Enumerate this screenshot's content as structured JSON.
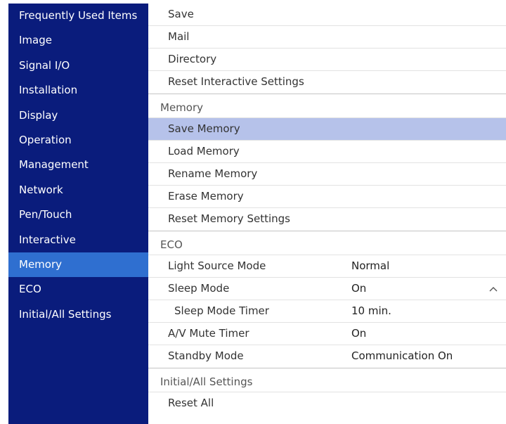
{
  "sidebar": {
    "items": [
      {
        "label": "Frequently Used Items"
      },
      {
        "label": "Image"
      },
      {
        "label": "Signal I/O"
      },
      {
        "label": "Installation"
      },
      {
        "label": "Display"
      },
      {
        "label": "Operation"
      },
      {
        "label": "Management"
      },
      {
        "label": "Network"
      },
      {
        "label": "Pen/Touch"
      },
      {
        "label": "Interactive"
      },
      {
        "label": "Memory"
      },
      {
        "label": "ECO"
      },
      {
        "label": "Initial/All Settings"
      }
    ],
    "active": "Memory"
  },
  "main": {
    "top_items": [
      {
        "label": "Save"
      },
      {
        "label": "Mail"
      },
      {
        "label": "Directory"
      },
      {
        "label": "Reset Interactive Settings"
      }
    ],
    "memory": {
      "heading": "Memory",
      "items": [
        {
          "label": "Save Memory"
        },
        {
          "label": "Load Memory"
        },
        {
          "label": "Rename Memory"
        },
        {
          "label": "Erase Memory"
        },
        {
          "label": "Reset Memory Settings"
        }
      ]
    },
    "eco": {
      "heading": "ECO",
      "items": [
        {
          "label": "Light Source Mode",
          "value": "Normal"
        },
        {
          "label": "Sleep Mode",
          "value": "On"
        },
        {
          "label": "Sleep Mode Timer",
          "value": "10 min."
        },
        {
          "label": "A/V Mute Timer",
          "value": "On"
        },
        {
          "label": "Standby Mode",
          "value": "Communication On"
        }
      ]
    },
    "initial": {
      "heading": "Initial/All Settings",
      "items": [
        {
          "label": "Reset All"
        }
      ]
    }
  },
  "colors": {
    "sidebar_bg": "#0a1c7c",
    "sidebar_active": "#2f6fd0",
    "row_selected": "#b6c2ea"
  },
  "icons": {
    "expand": "chevron-up-icon"
  }
}
